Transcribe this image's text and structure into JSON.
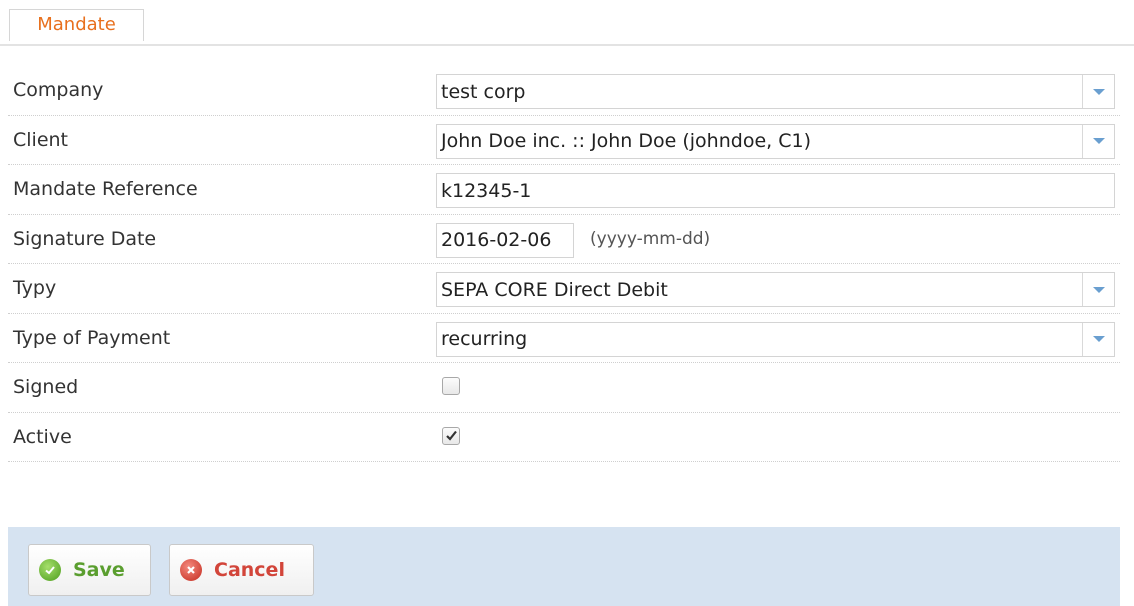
{
  "tab": {
    "label": "Mandate"
  },
  "form": {
    "company": {
      "label": "Company",
      "value": "test corp"
    },
    "client": {
      "label": "Client",
      "value": "John Doe inc. :: John Doe (johndoe, C1)"
    },
    "mandate_reference": {
      "label": "Mandate Reference",
      "value": "k12345-1"
    },
    "signature_date": {
      "label": "Signature Date",
      "value": "2016-02-06",
      "hint": "(yyyy-mm-dd)"
    },
    "typy": {
      "label": "Typy",
      "value": "SEPA CORE Direct Debit"
    },
    "type_of_payment": {
      "label": "Type of Payment",
      "value": "recurring"
    },
    "signed": {
      "label": "Signed",
      "checked": false
    },
    "active": {
      "label": "Active",
      "checked": true
    }
  },
  "footer": {
    "save_label": "Save",
    "cancel_label": "Cancel"
  },
  "colors": {
    "tab_text": "#e8701e",
    "footer_bg": "#d6e3f1",
    "save_text": "#5a9e2f",
    "cancel_text": "#d2453a",
    "select_arrow": "#6a9fd0"
  },
  "icons": {
    "dropdown": "chevron-down-icon",
    "save": "check-circle-icon",
    "cancel": "x-circle-icon",
    "checkbox": "checkmark-icon"
  }
}
